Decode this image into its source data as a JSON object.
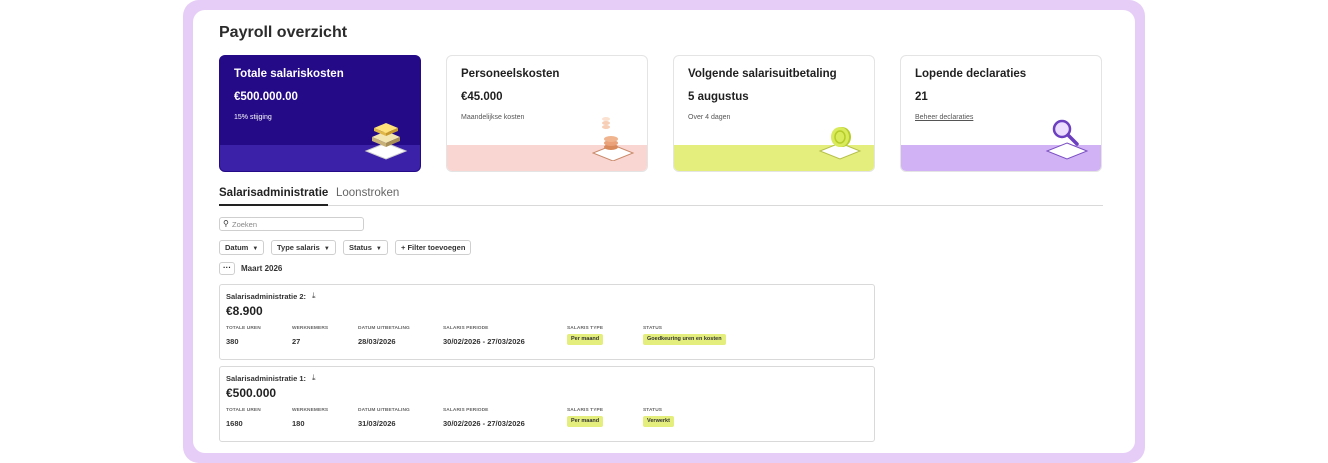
{
  "page": {
    "title": "Payroll overzicht"
  },
  "cards": [
    {
      "title": "Totale salariskosten",
      "value": "€500.000.00",
      "sub": "15% stijging",
      "icon": "layers-icon",
      "color": "#240a87",
      "band": "#3b20a8"
    },
    {
      "title": "Personeelskosten",
      "value": "€45.000",
      "sub": "Maandelijkse kosten",
      "icon": "coins-icon",
      "band": "#fad6d2"
    },
    {
      "title": "Volgende salarisuitbetaling",
      "value": "5 augustus",
      "sub": "Over 4 dagen",
      "icon": "coin-icon",
      "band": "#e3ee7c"
    },
    {
      "title": "Lopende declaraties",
      "value": "21",
      "sub": "Beheer declaraties",
      "icon": "magnifier-icon",
      "band": "#d1b3f5"
    }
  ],
  "tabs": [
    {
      "label": "Salarisadministratie",
      "active": true
    },
    {
      "label": "Loonstroken",
      "active": false
    }
  ],
  "search": {
    "placeholder": "Zoeken"
  },
  "filters": {
    "datum": "Datum",
    "type": "Type salaris",
    "status": "Status",
    "add": "Filter toevoegen"
  },
  "group": {
    "month": "Maart 2026"
  },
  "columns": {
    "uren": "TOTALE UREN",
    "werknemers": "WERKNEMERS",
    "datum": "DATUM UITBETALING",
    "periode": "SALARIS PERIODE",
    "type": "SALARIS TYPE",
    "status": "STATUS"
  },
  "runs": [
    {
      "title": "Salarisadministratie 2:",
      "amount": "€8.900",
      "uren": "380",
      "werknemers": "27",
      "datum": "28/03/2026",
      "periode": "30/02/2026 - 27/03/2026",
      "type": "Per maand",
      "status": "Goedkeuring uren en kosten"
    },
    {
      "title": "Salarisadministratie 1:",
      "amount": "€500.000",
      "uren": "1680",
      "werknemers": "180",
      "datum": "31/03/2026",
      "periode": "30/02/2026 - 27/03/2026",
      "type": "Per maand",
      "status": "Verwerkt"
    }
  ]
}
